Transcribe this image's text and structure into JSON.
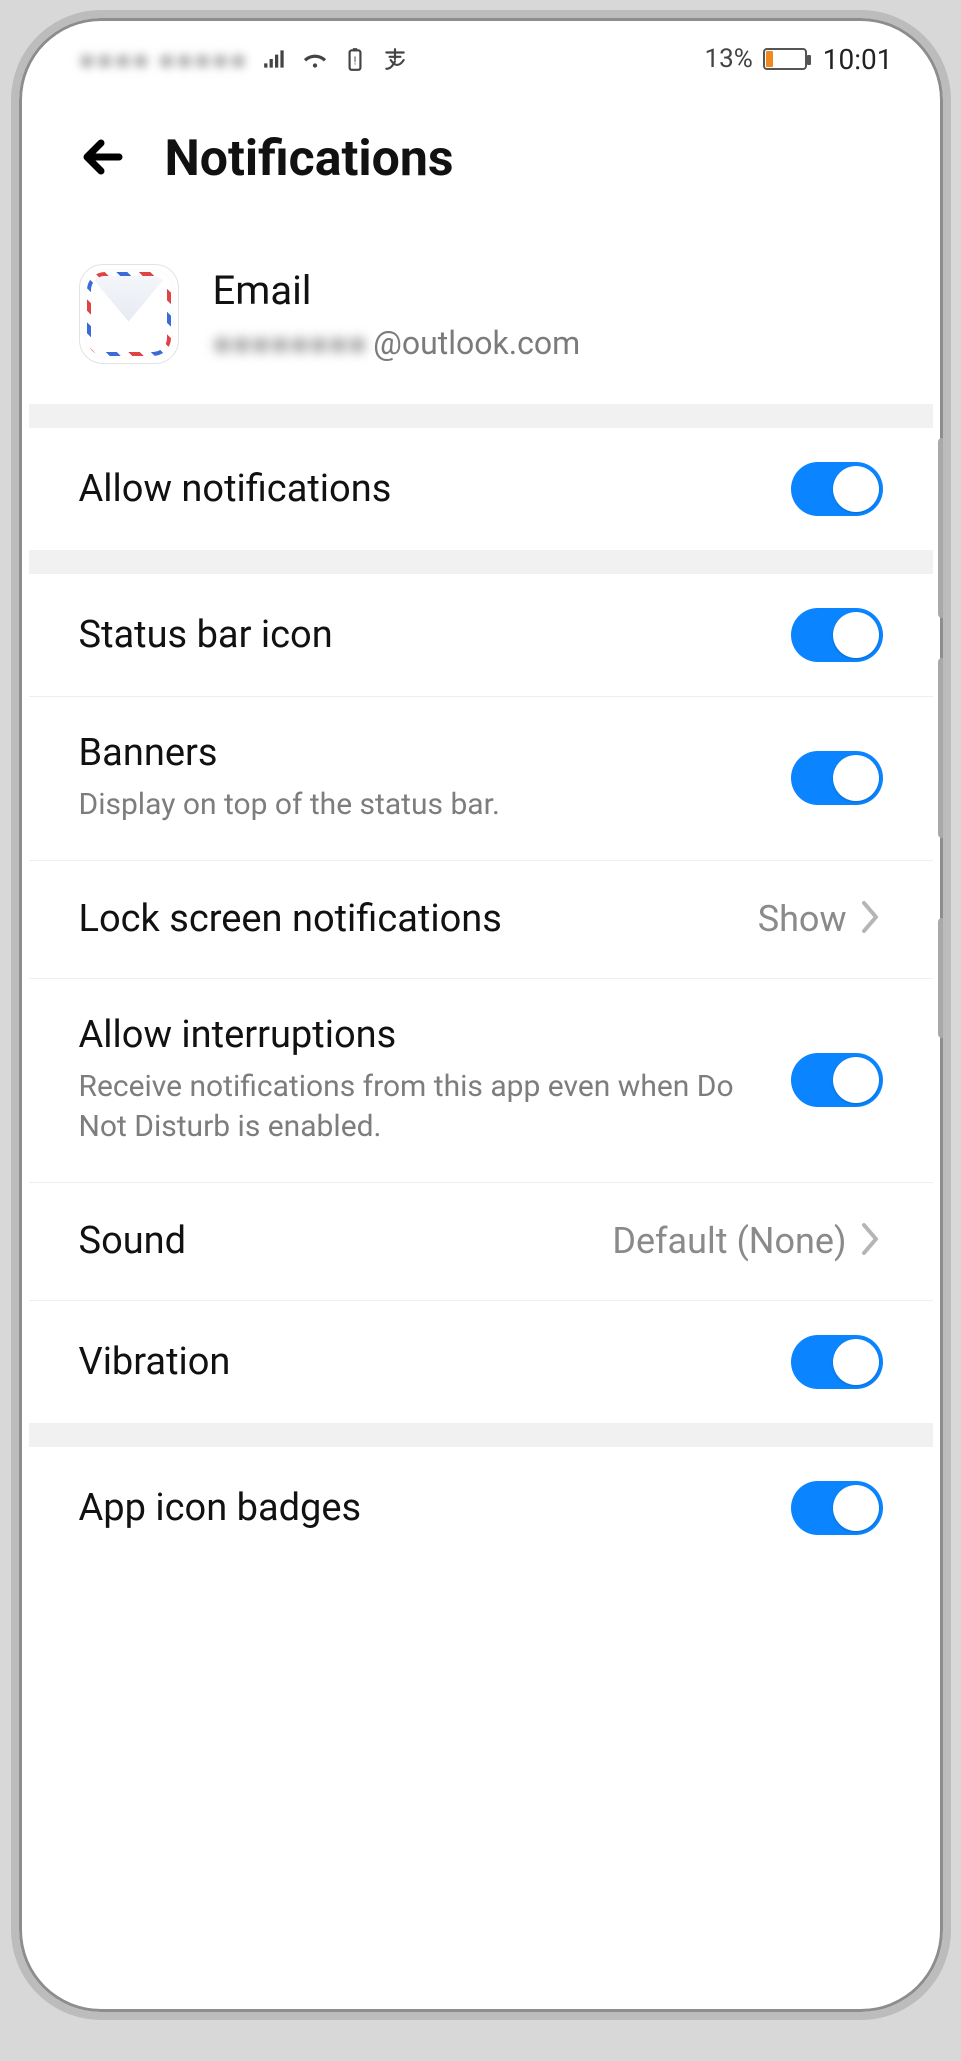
{
  "statusbar": {
    "carrier_blurred": "●●●● ●●●●●",
    "battery_pct": "13%",
    "time": "10:01"
  },
  "header": {
    "title": "Notifications"
  },
  "app": {
    "name": "Email",
    "address_blurred": "●●●●●●●●",
    "address_suffix": "@outlook.com"
  },
  "groups": [
    {
      "rows": [
        {
          "key": "allow_notifications",
          "label": "Allow notifications",
          "type": "toggle",
          "on": true
        }
      ]
    },
    {
      "rows": [
        {
          "key": "status_bar_icon",
          "label": "Status bar icon",
          "type": "toggle",
          "on": true
        },
        {
          "key": "banners",
          "label": "Banners",
          "desc": "Display on top of the status bar.",
          "type": "toggle",
          "on": true
        },
        {
          "key": "lock_screen",
          "label": "Lock screen notifications",
          "type": "link",
          "value": "Show"
        },
        {
          "key": "allow_interruptions",
          "label": "Allow interruptions",
          "desc": "Receive notifications from this app even when Do Not Disturb is enabled.",
          "type": "toggle",
          "on": true
        },
        {
          "key": "sound",
          "label": "Sound",
          "type": "link",
          "value": "Default (None)"
        },
        {
          "key": "vibration",
          "label": "Vibration",
          "type": "toggle",
          "on": true
        }
      ]
    },
    {
      "rows": [
        {
          "key": "app_icon_badges",
          "label": "App icon badges",
          "type": "toggle",
          "on": true
        }
      ]
    }
  ]
}
